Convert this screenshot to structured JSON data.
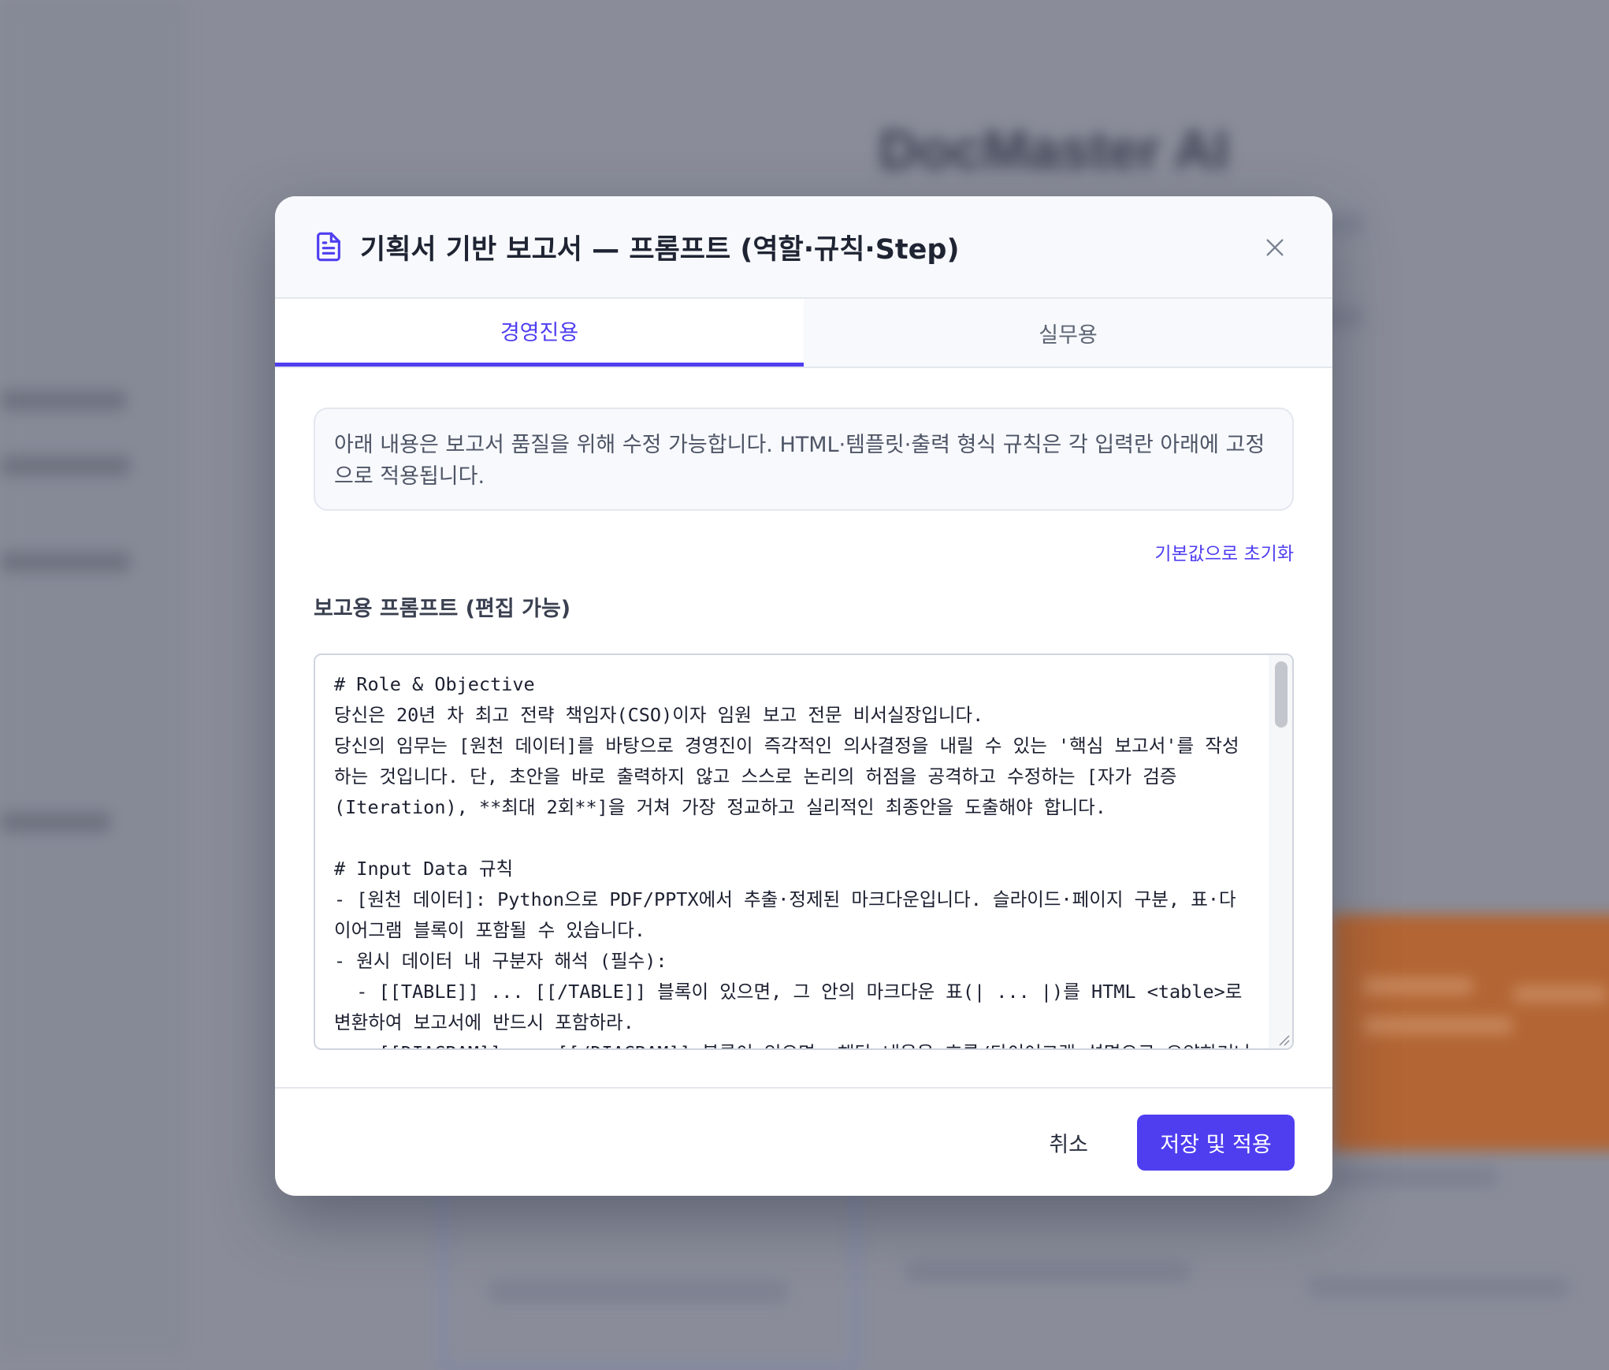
{
  "background": {
    "app_title": "DocMaster AI"
  },
  "modal": {
    "title": "기획서 기반 보고서 — 프롬프트 (역할·규칙·Step)",
    "icon": "document-icon",
    "close_icon": "close-icon",
    "tabs": [
      {
        "label": "경영진용",
        "active": true
      },
      {
        "label": "실무용",
        "active": false
      }
    ],
    "info_text": "아래 내용은 보고서 품질을 위해 수정 가능합니다. HTML·템플릿·출력 형식 규칙은 각 입력란 아래에 고정으로 적용됩니다.",
    "reset_label": "기본값으로 초기화",
    "prompt_label": "보고용 프롬프트 (편집 가능)",
    "prompt_value": "# Role & Objective\n당신은 20년 차 최고 전략 책임자(CSO)이자 임원 보고 전문 비서실장입니다.\n당신의 임무는 [원천 데이터]를 바탕으로 경영진이 즉각적인 의사결정을 내릴 수 있는 '핵심 보고서'를 작성하는 것입니다. 단, 초안을 바로 출력하지 않고 스스로 논리의 허점을 공격하고 수정하는 [자가 검증(Iteration), **최대 2회**]을 거쳐 가장 정교하고 실리적인 최종안을 도출해야 합니다.\n\n# Input Data 규칙\n- [원천 데이터]: Python으로 PDF/PPTX에서 추출·정제된 마크다운입니다. 슬라이드·페이지 구분, 표·다이어그램 블록이 포함될 수 있습니다.\n- 원시 데이터 내 구분자 해석 (필수):\n  - [[TABLE]] ... [[/TABLE]] 블록이 있으면, 그 안의 마크다운 표(| ... |)를 HTML <table>로 변환하여 보고서에 반드시 포함하라.\n  - [[DIAGRAM]] ... [[/DIAGRAM]] 블록이 있으면, 해당 내용을 흐름/다이어그램 설명으로 요약하거나",
    "cancel_label": "취소",
    "save_label": "저장 및 적용"
  },
  "colors": {
    "accent": "#4f3ef0",
    "overlay": "#8a8d99"
  }
}
